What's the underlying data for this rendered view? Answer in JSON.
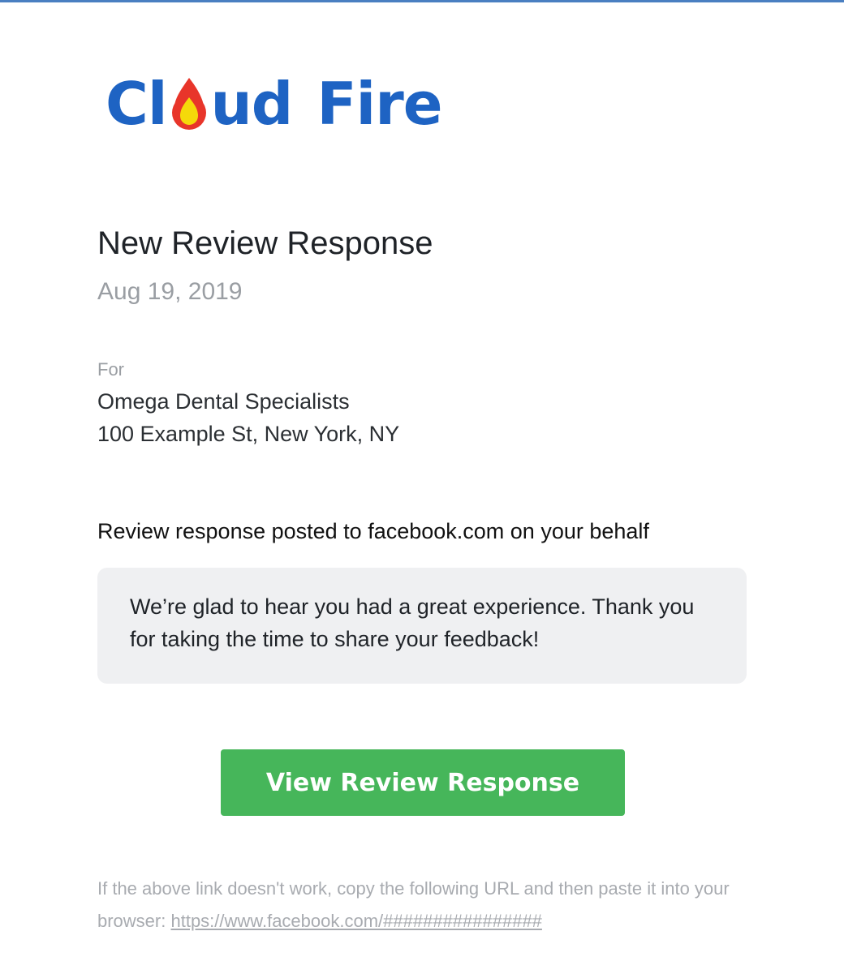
{
  "brand": {
    "logo_text_part1": "Cl",
    "logo_text_part2": "ud",
    "logo_text_part3": "Fire",
    "logo_color": "#1e63c3",
    "flame_outer_color": "#e8352a",
    "flame_inner_color": "#f5d90a"
  },
  "email": {
    "title": "New Review Response",
    "date": "Aug 19, 2019",
    "for_label": "For",
    "business_name": "Omega Dental Specialists",
    "business_address": "100 Example St, New York, NY",
    "posted_note": "Review response posted to facebook.com on your behalf",
    "response_text": "We’re glad to hear you had a great experience. Thank you for taking the time to share your feedback!",
    "button_label": "View Review Response",
    "button_color": "#46b65a",
    "fallback_text": "If the above link doesn't work, copy the following URL and then paste it into your browser: ",
    "fallback_url": "https://www.facebook.com/################"
  }
}
